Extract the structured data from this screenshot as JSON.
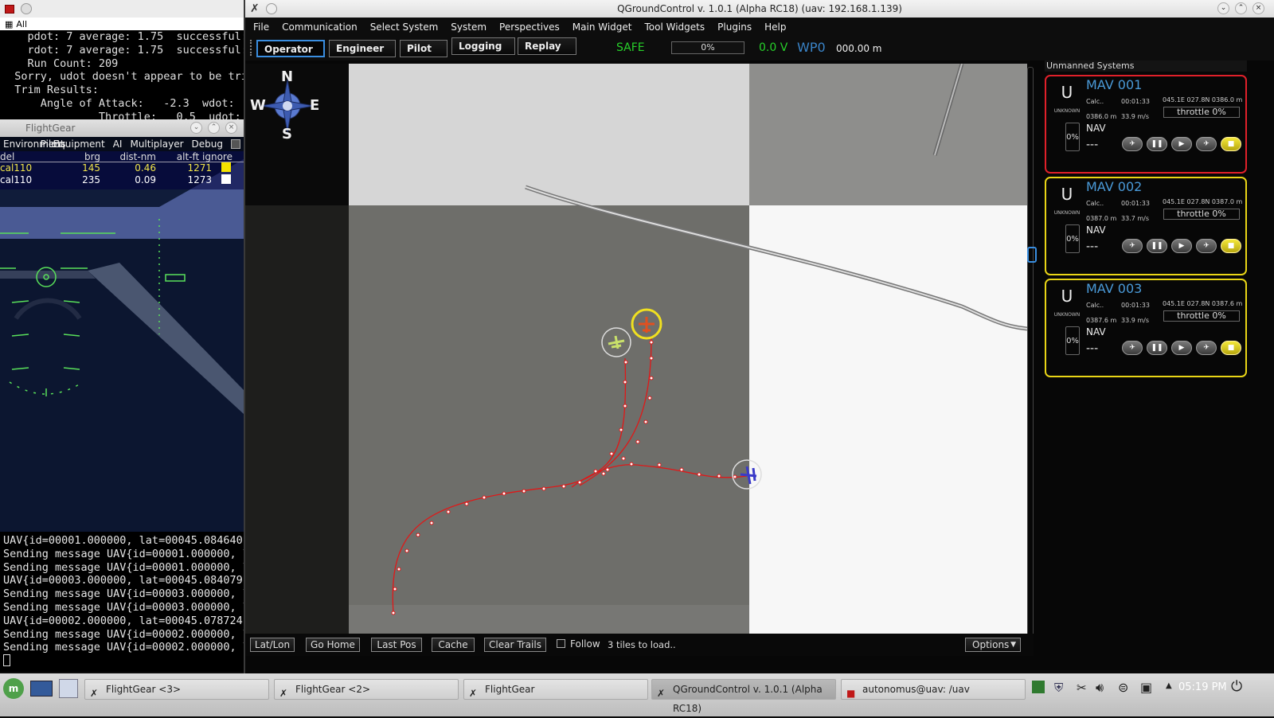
{
  "terminal_top": {
    "tab_label": "All",
    "lines": [
      "    pdot: 7 average: 1.75  successful:",
      "    rdot: 7 average: 1.75  successful:",
      "    Run Count: 209",
      "  Sorry, udot doesn't appear to be tri",
      "  Trim Results:",
      "      Angle of Attack:   -2.3  wdot:",
      "               Throttle:   0.5  udot:"
    ]
  },
  "flightgear": {
    "title": "FlightGear",
    "menu": [
      "Environment",
      "Pilots",
      "Equipment",
      "AI",
      "Multiplayer",
      "Debug"
    ],
    "traffic_header": [
      "del",
      "brg",
      "dist-nm",
      "alt-ft ignore"
    ],
    "traffic_rows": [
      {
        "callsign": "cal110",
        "brg": "145",
        "dist": "0.46",
        "alt": "1271"
      },
      {
        "callsign": "cal110",
        "brg": "235",
        "dist": "0.09",
        "alt": "1273"
      }
    ]
  },
  "terminal_bottom": {
    "lines": [
      "UAV{id=00001.000000, lat=00045.084640,",
      "Sending message UAV{id=00001.000000, l",
      "Sending message UAV{id=00001.000000, l",
      "UAV{id=00003.000000, lat=00045.084079,",
      "Sending message UAV{id=00003.000000, l",
      "Sending message UAV{id=00003.000000, l",
      "UAV{id=00002.000000, lat=00045.078724,",
      "Sending message UAV{id=00002.000000, l",
      "Sending message UAV{id=00002.000000, l"
    ]
  },
  "qgc": {
    "title": "QGroundControl v. 1.0.1 (Alpha RC18) (uav: 192.168.1.139)",
    "menu": [
      "File",
      "Communication",
      "Select System",
      "System",
      "Perspectives",
      "Main Widget",
      "Tool Widgets",
      "Plugins",
      "Help"
    ],
    "perspectives": {
      "operator": "Operator",
      "engineer": "Engineer",
      "pilot": "Pilot",
      "logging": "Logging",
      "replay": "Replay"
    },
    "status": {
      "mode": "SAFE",
      "progress": "0%",
      "voltage": "0.0 V",
      "waypoint": "WP0",
      "distance": "000.00 m"
    },
    "compass": {
      "n": "N",
      "s": "S",
      "e": "E",
      "w": "W"
    },
    "bottom": {
      "latlon": "Lat/Lon",
      "go_home": "Go Home",
      "last_pos": "Last Pos",
      "cache": "Cache",
      "clear_trails": "Clear Trails",
      "follow": "Follow",
      "tiles": "3 tiles to load..",
      "options": "Options"
    },
    "panel_title": "Unmanned Systems",
    "mavs": [
      {
        "name": "MAV 001",
        "letter": "U",
        "type": "UNKNOWN",
        "battery": "0%",
        "calc": "Calc..",
        "time": "00:01:33",
        "pos": "045.1E 027.8N 0386.0 m",
        "alt": "0386.0 m",
        "speed": "33.9 m/s",
        "throttle": "throttle 0%",
        "nav": "NAV",
        "dash": "---",
        "border": "#e0202a"
      },
      {
        "name": "MAV 002",
        "letter": "U",
        "type": "UNKNOWN",
        "battery": "0%",
        "calc": "Calc..",
        "time": "00:01:33",
        "pos": "045.1E 027.8N 0387.0 m",
        "alt": "0387.0 m",
        "speed": "33.7 m/s",
        "throttle": "throttle 0%",
        "nav": "NAV",
        "dash": "---",
        "border": "#e9d516"
      },
      {
        "name": "MAV 003",
        "letter": "U",
        "type": "UNKNOWN",
        "battery": "0%",
        "calc": "Calc..",
        "time": "00:01:33",
        "pos": "045.1E 027.8N 0387.6 m",
        "alt": "0387.6 m",
        "speed": "33.9 m/s",
        "throttle": "throttle 0%",
        "nav": "NAV",
        "dash": "---",
        "border": "#e9d516"
      }
    ]
  },
  "taskbar": {
    "items": [
      "FlightGear <3>",
      "FlightGear <2>",
      "FlightGear",
      "QGroundControl v. 1.0.1 (Alpha RC18)",
      "autonomus@uav: /uav"
    ],
    "clock": "05:19 PM"
  }
}
